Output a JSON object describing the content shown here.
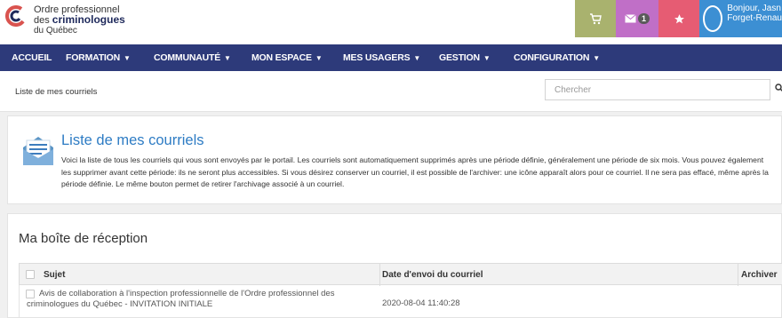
{
  "header": {
    "logo_line1": "Ordre professionnel",
    "logo_line2_prefix": "des ",
    "logo_line2_bold": "criminologues",
    "logo_line3": "du Québec",
    "mail_count": "1",
    "user_greeting": "Bonjour, Jasn",
    "user_name": "Forget-Renau",
    "colors": {
      "cart": "#a9b26e",
      "mail": "#c06fc7",
      "favorites": "#e65c73",
      "user": "#3c8fd3",
      "nav": "#2d3a7a"
    }
  },
  "nav": {
    "items": [
      {
        "label": "ACCUEIL",
        "caret": false
      },
      {
        "label": "FORMATION",
        "caret": true
      },
      {
        "label": "COMMUNAUTÉ",
        "caret": true
      },
      {
        "label": "MON ESPACE",
        "caret": true
      },
      {
        "label": "MES USAGERS",
        "caret": true
      },
      {
        "label": "GESTION",
        "caret": true
      },
      {
        "label": "CONFIGURATION",
        "caret": true
      }
    ]
  },
  "breadcrumb": "Liste de mes courriels",
  "search": {
    "placeholder": "Chercher"
  },
  "info": {
    "title": "Liste de mes courriels",
    "text": "Voici la liste de tous les courriels qui vous sont envoyés par le portail. Les courriels sont automatiquement supprimés après une période définie, généralement une période de six mois. Vous pouvez également les supprimer avant cette période: ils ne seront plus accessibles. Si vous désirez conserver un courriel, il est possible de l'archiver: une icône apparaît alors pour ce courriel. Il ne sera pas effacé, même après la période définie. Le même bouton permet de retirer l'archivage associé à un courriel."
  },
  "inbox": {
    "title": "Ma boîte de réception",
    "columns": [
      "Sujet",
      "Date d'envoi du courriel",
      "Archiver"
    ],
    "rows": [
      {
        "subject": "Avis de collaboration à l'inspection professionnelle de l'Ordre professionnel des criminologues du Québec - INVITATION INITIALE",
        "date": "2020-08-04 11:40:28"
      }
    ]
  }
}
